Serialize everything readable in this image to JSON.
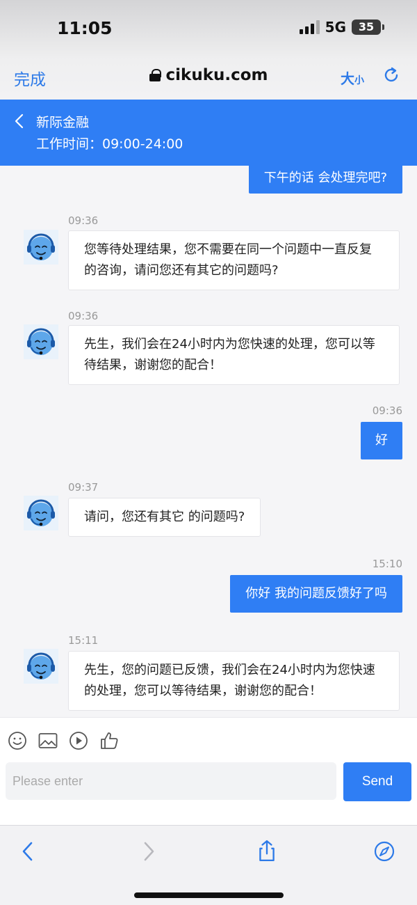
{
  "status_bar": {
    "time": "11:05",
    "network": "5G",
    "battery": "35"
  },
  "browser": {
    "done_label": "完成",
    "url": "cikuku.com",
    "text_size_big": "大",
    "text_size_small": "小"
  },
  "chat_header": {
    "title": "新际金融",
    "hours": "工作时间：09:00-24:00"
  },
  "messages": [
    {
      "from": "user",
      "time": "",
      "text": "下午的话 会处理完吧?"
    },
    {
      "from": "agent",
      "time": "09:36",
      "text": "您等待处理结果，您不需要在同一个问题中一直反复的咨询，请问您还有其它的问题吗?"
    },
    {
      "from": "agent",
      "time": "09:36",
      "text": "先生，我们会在24小时内为您快速的处理，您可以等待结果，谢谢您的配合！"
    },
    {
      "from": "user",
      "time": "09:36",
      "text": "好"
    },
    {
      "from": "agent",
      "time": "09:37",
      "text": "请问，您还有其它 的问题吗?"
    },
    {
      "from": "user",
      "time": "15:10",
      "text": "你好 我的问题反馈好了吗"
    },
    {
      "from": "agent",
      "time": "15:11",
      "text": "先生，您的问题已反馈，我们会在24小时内为您快速的处理，您可以等待结果，谢谢您的配合！"
    }
  ],
  "composer": {
    "icons": [
      "emoji-icon",
      "image-icon",
      "video-icon",
      "thumbs-up-icon"
    ],
    "placeholder": "Please enter",
    "send_label": "Send"
  },
  "colors": {
    "accent": "#2f7ef4",
    "link": "#2d7ae8",
    "background": "#f5f5f7"
  }
}
